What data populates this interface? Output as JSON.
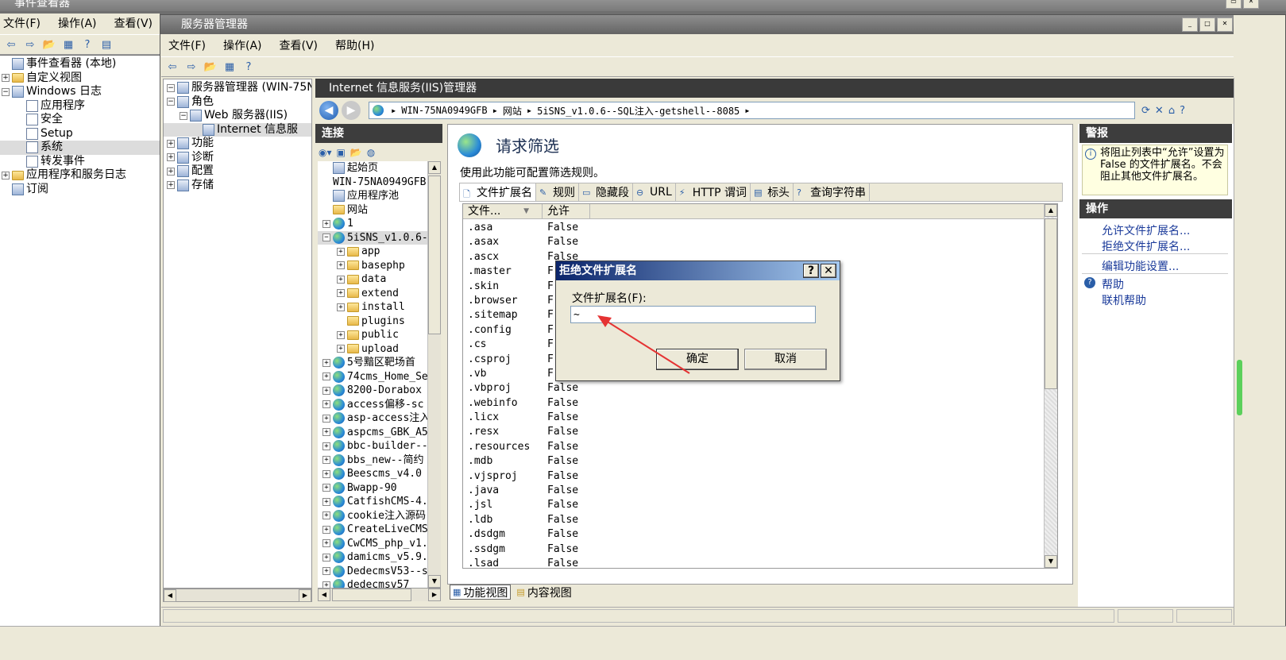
{
  "outer": {
    "title": "事件查看器",
    "menu": [
      "文件(F)",
      "操作(A)",
      "查看(V)"
    ],
    "tree": [
      {
        "label": "事件查看器 (本地)",
        "level": 0,
        "exp": "",
        "icon": "app"
      },
      {
        "label": "自定义视图",
        "level": 0,
        "exp": "+",
        "icon": "folder"
      },
      {
        "label": "Windows 日志",
        "level": 0,
        "exp": "-",
        "icon": "app"
      },
      {
        "label": "应用程序",
        "level": 1,
        "exp": "",
        "icon": "doc"
      },
      {
        "label": "安全",
        "level": 1,
        "exp": "",
        "icon": "doc"
      },
      {
        "label": "Setup",
        "level": 1,
        "exp": "",
        "icon": "doc"
      },
      {
        "label": "系统",
        "level": 1,
        "exp": "",
        "icon": "doc"
      },
      {
        "label": "转发事件",
        "level": 1,
        "exp": "",
        "icon": "doc"
      },
      {
        "label": "应用程序和服务日志",
        "level": 0,
        "exp": "+",
        "icon": "folder"
      },
      {
        "label": "订阅",
        "level": 0,
        "exp": "",
        "icon": "app"
      }
    ]
  },
  "server_manager": {
    "title": "服务器管理器",
    "menu": [
      "文件(F)",
      "操作(A)",
      "查看(V)",
      "帮助(H)"
    ],
    "tree": [
      {
        "label": "服务器管理器 (WIN-75NA",
        "level": 0,
        "exp": "-",
        "icon": "app"
      },
      {
        "label": "角色",
        "level": 0,
        "exp": "-",
        "icon": "app"
      },
      {
        "label": "Web 服务器(IIS)",
        "level": 1,
        "exp": "-",
        "icon": "app"
      },
      {
        "label": "Internet 信息服",
        "level": 2,
        "exp": "",
        "icon": "app"
      },
      {
        "label": "功能",
        "level": 0,
        "exp": "+",
        "icon": "app"
      },
      {
        "label": "诊断",
        "level": 0,
        "exp": "+",
        "icon": "app"
      },
      {
        "label": "配置",
        "level": 0,
        "exp": "+",
        "icon": "app"
      },
      {
        "label": "存储",
        "level": 0,
        "exp": "+",
        "icon": "app"
      }
    ]
  },
  "iis": {
    "title": "Internet 信息服务(IIS)管理器",
    "breadcrumb": [
      "WIN-75NA0949GFB",
      "网站",
      "5iSNS_v1.0.6--SQL注入-getshell--8085"
    ],
    "connections_title": "连接",
    "connections": [
      {
        "label": "起始页",
        "level": 0,
        "exp": "",
        "icon": "app"
      },
      {
        "label": "WIN-75NA0949GFB (",
        "level": 0,
        "exp": "",
        "icon": "none"
      },
      {
        "label": "应用程序池",
        "level": 0,
        "exp": "",
        "icon": "app"
      },
      {
        "label": "网站",
        "level": 0,
        "exp": "",
        "icon": "folder"
      },
      {
        "label": "1",
        "level": 0,
        "exp": "+",
        "icon": "globe"
      },
      {
        "label": "5iSNS_v1.0.6-",
        "level": 0,
        "exp": "-",
        "icon": "globe"
      },
      {
        "label": "app",
        "level": 1,
        "exp": "+",
        "icon": "folder"
      },
      {
        "label": "basephp",
        "level": 1,
        "exp": "+",
        "icon": "folder"
      },
      {
        "label": "data",
        "level": 1,
        "exp": "+",
        "icon": "folder"
      },
      {
        "label": "extend",
        "level": 1,
        "exp": "+",
        "icon": "folder"
      },
      {
        "label": "install",
        "level": 1,
        "exp": "+",
        "icon": "folder"
      },
      {
        "label": "plugins",
        "level": 1,
        "exp": "",
        "icon": "folder"
      },
      {
        "label": "public",
        "level": 1,
        "exp": "+",
        "icon": "folder"
      },
      {
        "label": "upload",
        "level": 1,
        "exp": "+",
        "icon": "folder"
      },
      {
        "label": "5号黯区靶场首",
        "level": 0,
        "exp": "+",
        "icon": "globe"
      },
      {
        "label": "74cms_Home_Se",
        "level": 0,
        "exp": "+",
        "icon": "globe"
      },
      {
        "label": "8200-Dorabox",
        "level": 0,
        "exp": "+",
        "icon": "globe"
      },
      {
        "label": "access偏移-sc",
        "level": 0,
        "exp": "+",
        "icon": "globe"
      },
      {
        "label": "asp-access注入",
        "level": 0,
        "exp": "+",
        "icon": "globe"
      },
      {
        "label": "aspcms_GBK_A5",
        "level": 0,
        "exp": "+",
        "icon": "globe"
      },
      {
        "label": "bbc-builder--",
        "level": 0,
        "exp": "+",
        "icon": "globe"
      },
      {
        "label": "bbs_new--简约",
        "level": 0,
        "exp": "+",
        "icon": "globe"
      },
      {
        "label": "Beescms_v4.0",
        "level": 0,
        "exp": "+",
        "icon": "globe"
      },
      {
        "label": "Bwapp-90",
        "level": 0,
        "exp": "+",
        "icon": "globe"
      },
      {
        "label": "CatfishCMS-4.",
        "level": 0,
        "exp": "+",
        "icon": "globe"
      },
      {
        "label": "cookie注入源码",
        "level": 0,
        "exp": "+",
        "icon": "globe"
      },
      {
        "label": "CreateLiveCMS",
        "level": 0,
        "exp": "+",
        "icon": "globe"
      },
      {
        "label": "CwCMS_php_v1.",
        "level": 0,
        "exp": "+",
        "icon": "globe"
      },
      {
        "label": "damicms_v5.9.",
        "level": 0,
        "exp": "+",
        "icon": "globe"
      },
      {
        "label": "DedecmsV53--s",
        "level": 0,
        "exp": "+",
        "icon": "globe"
      },
      {
        "label": "dedecmsv57",
        "level": 0,
        "exp": "+",
        "icon": "globe"
      }
    ],
    "feature_title": "请求筛选",
    "feature_desc": "使用此功能可配置筛选规则。",
    "tabs": [
      "文件扩展名",
      "规则",
      "隐藏段",
      "URL",
      "HTTP 谓词",
      "标头",
      "查询字符串"
    ],
    "columns": [
      "文件...",
      "允许"
    ],
    "rows": [
      [
        ".asa",
        "False"
      ],
      [
        ".asax",
        "False"
      ],
      [
        ".ascx",
        "False"
      ],
      [
        ".master",
        "F"
      ],
      [
        ".skin",
        "F"
      ],
      [
        ".browser",
        "F"
      ],
      [
        ".sitemap",
        "F"
      ],
      [
        ".config",
        "F"
      ],
      [
        ".cs",
        "F"
      ],
      [
        ".csproj",
        "F"
      ],
      [
        ".vb",
        "F"
      ],
      [
        ".vbproj",
        "False"
      ],
      [
        ".webinfo",
        "False"
      ],
      [
        ".licx",
        "False"
      ],
      [
        ".resx",
        "False"
      ],
      [
        ".resources",
        "False"
      ],
      [
        ".mdb",
        "False"
      ],
      [
        ".vjsproj",
        "False"
      ],
      [
        ".java",
        "False"
      ],
      [
        ".jsl",
        "False"
      ],
      [
        ".ldb",
        "False"
      ],
      [
        ".dsdgm",
        "False"
      ],
      [
        ".ssdgm",
        "False"
      ],
      [
        ".lsad",
        "False"
      ]
    ],
    "bottom_tabs": [
      "功能视图",
      "内容视图"
    ],
    "alerts_title": "警报",
    "alert_text": "将阻止列表中“允许”设置为 False 的文件扩展名。不会阻止其他文件扩展名。",
    "actions_title": "操作",
    "actions": [
      "允许文件扩展名...",
      "拒绝文件扩展名...",
      "编辑功能设置..."
    ],
    "help": [
      "帮助",
      "联机帮助"
    ]
  },
  "dialog": {
    "title": "拒绝文件扩展名",
    "field_label": "文件扩展名(F):",
    "field_value": "~",
    "ok": "确定",
    "cancel": "取消"
  },
  "colors": {
    "accent": "#e53333",
    "title_active": "#0a246a"
  }
}
